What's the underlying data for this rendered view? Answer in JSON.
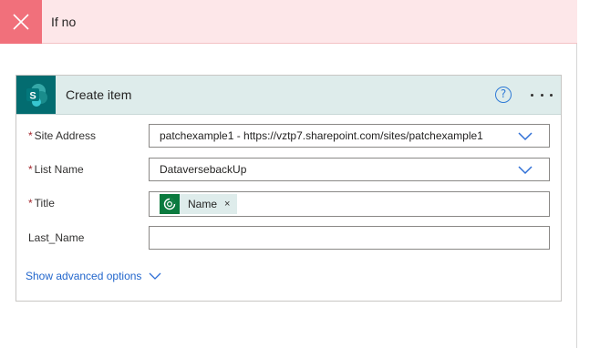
{
  "condition": {
    "title": "If no",
    "icon": "close-icon",
    "color": "#f1707b"
  },
  "card": {
    "title": "Create item",
    "icon": "sharepoint-icon",
    "brand_color": "#036c70",
    "help_label": "?",
    "fields": [
      {
        "label": "Site Address",
        "required": true,
        "value": "patchexample1 - https://vztp7.sharepoint.com/sites/patchexample1",
        "dropdown": true
      },
      {
        "label": "List Name",
        "required": true,
        "value": "DataversebackUp",
        "dropdown": true
      },
      {
        "label": "Title",
        "required": true,
        "token": {
          "label": "Name",
          "remove": "×",
          "icon": "dataverse-icon"
        }
      },
      {
        "label": "Last_Name",
        "required": false,
        "value": ""
      }
    ],
    "required_marker": "*",
    "advanced_label": "Show advanced options"
  }
}
